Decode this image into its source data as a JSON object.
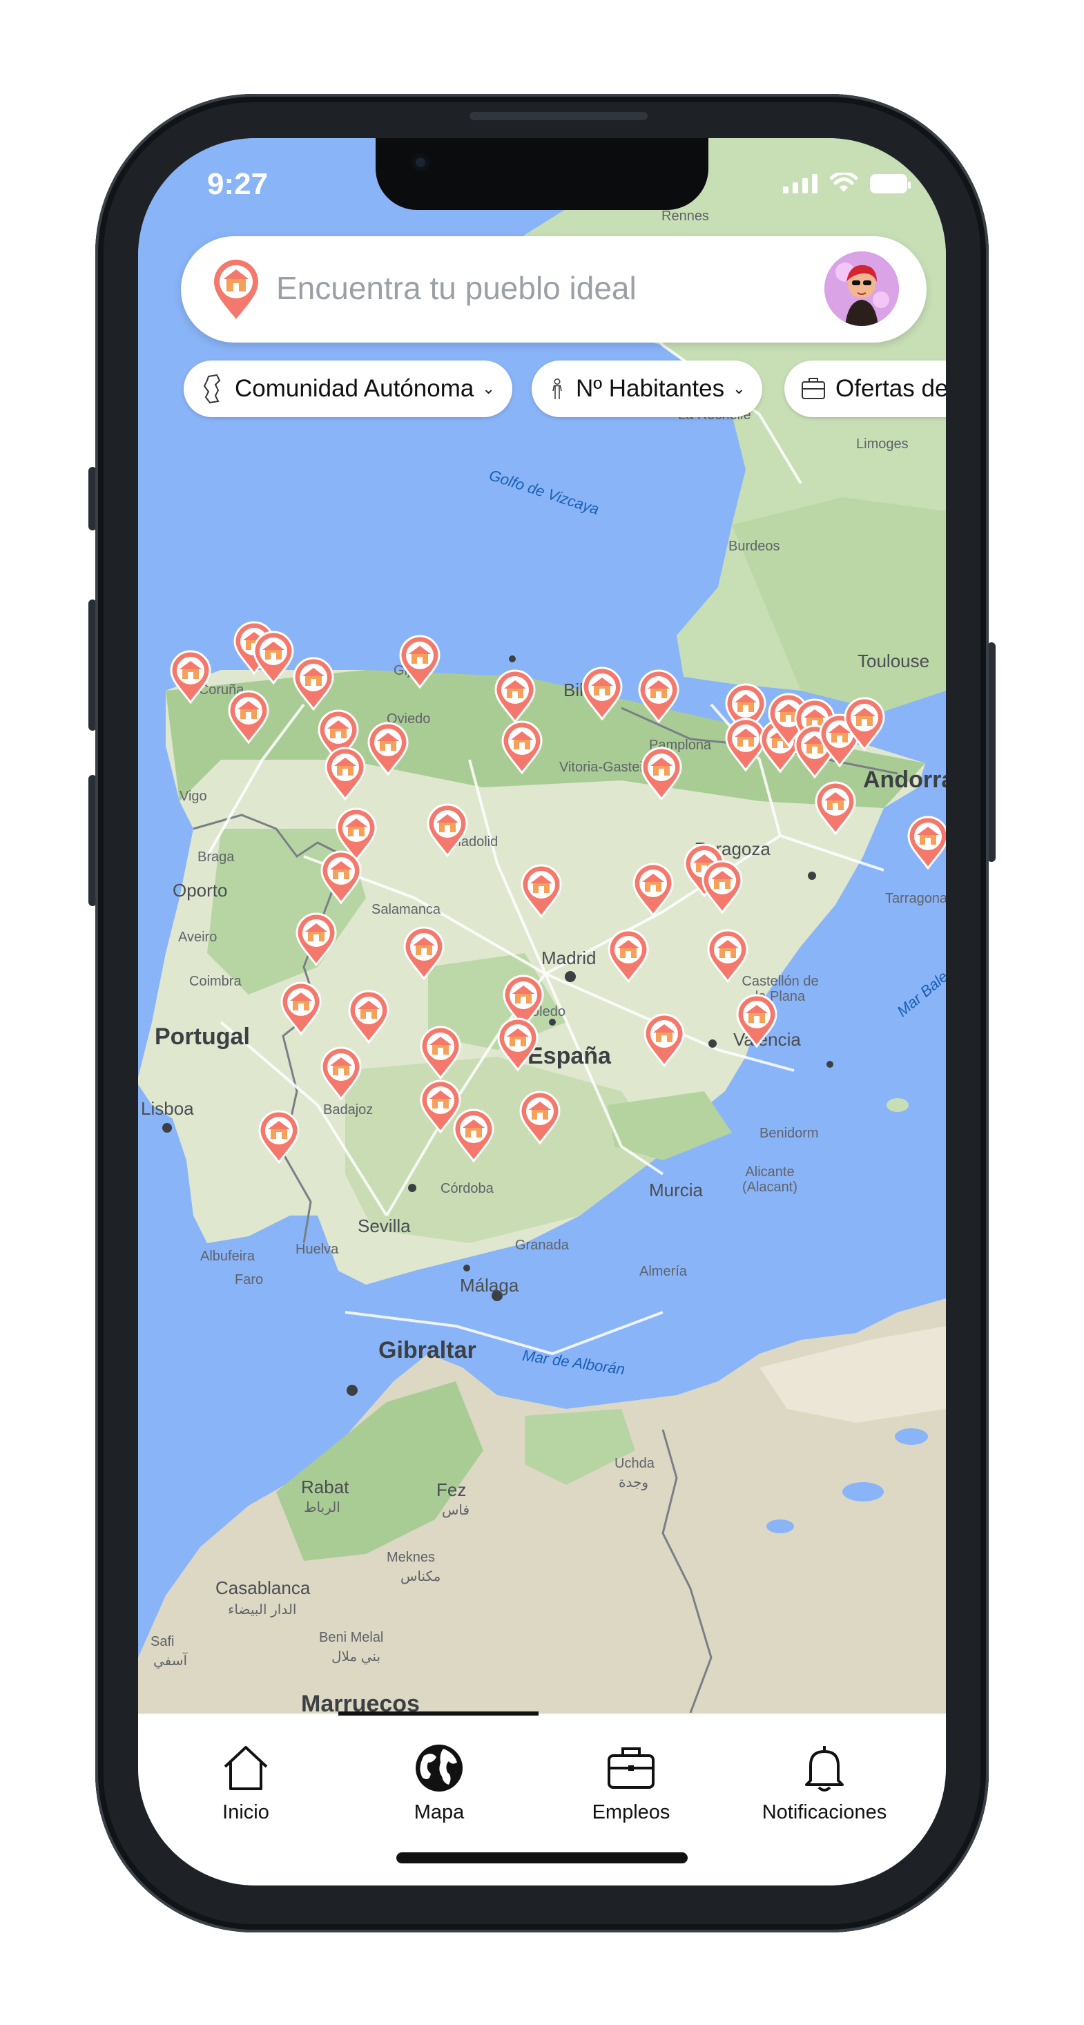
{
  "status_bar": {
    "time": "9:27"
  },
  "search": {
    "placeholder": "Encuentra tu pueblo ideal",
    "pin_icon": "pin-house-icon",
    "avatar_icon": "user-avatar"
  },
  "filters": [
    {
      "label": "Comunidad Autónoma",
      "icon": "map-region-icon",
      "has_dropdown": true
    },
    {
      "label": "Nº Habitantes",
      "icon": "person-icon",
      "has_dropdown": true
    },
    {
      "label": "Ofertas de",
      "icon": "briefcase-icon",
      "has_dropdown": false
    }
  ],
  "map": {
    "water_labels": [
      "Golfo de Vizcaya",
      "Mar de Alborán",
      "Mar Balear"
    ],
    "country_labels": [
      "Portugal",
      "España",
      "Marruecos",
      "Andorra"
    ],
    "city_labels": [
      "Rennes",
      "La Rochelle",
      "Limoges",
      "Burdeos",
      "Toulouse",
      "A Coruña",
      "Gijón",
      "Oviedo",
      "Bilbao",
      "Vitoria-Gasteiz",
      "Pamplona",
      "Vigo",
      "Braga",
      "Oporto",
      "Aveiro",
      "Coimbra",
      "Lisboa",
      "Valladolid",
      "Salamanca",
      "Zaragoza",
      "Tarragona",
      "Madrid",
      "Toledo",
      "Castellón de la Plana",
      "Valencia",
      "Badajoz",
      "Benidorm",
      "Alicante (Alacant)",
      "Murcia",
      "Córdoba",
      "Sevilla",
      "Huelva",
      "Granada",
      "Almería",
      "Málaga",
      "Albufeira",
      "Faro",
      "Gibraltar",
      "Rabat",
      "الرباط",
      "Fez",
      "فاس",
      "Meknes",
      "مكناس",
      "Casablanca",
      "الدار البيضاء",
      "Beni Melal",
      "بني ملال",
      "Uchda",
      "وجدة",
      "Safi",
      "آسفي"
    ],
    "pin_count": 47,
    "pin_icon": "town-pin-icon",
    "pin_color": "#f4786b",
    "pin_inner_color": "#f6a15a"
  },
  "tabs": [
    {
      "label": "Inicio",
      "icon": "home-icon",
      "active": false
    },
    {
      "label": "Mapa",
      "icon": "globe-icon",
      "active": true
    },
    {
      "label": "Empleos",
      "icon": "briefcase-icon",
      "active": false
    },
    {
      "label": "Notificaciones",
      "icon": "bell-icon",
      "active": false
    }
  ]
}
